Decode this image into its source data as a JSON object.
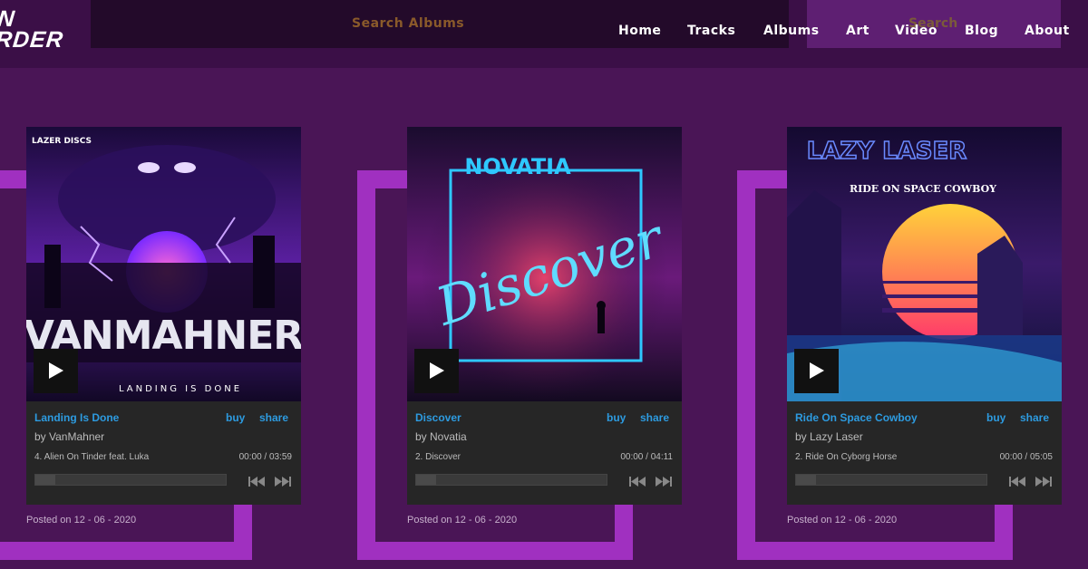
{
  "logo": {
    "line1": "N",
    "line2": "RDER"
  },
  "search": {
    "albums_placeholder": "Search Albums",
    "search_placeholder": "Search"
  },
  "nav": {
    "items": [
      "Home",
      "Tracks",
      "Albums",
      "Art",
      "Video",
      "Blog",
      "About"
    ]
  },
  "cards": [
    {
      "cover_text": "VANMAHNER",
      "cover_sub": "LANDING IS DONE",
      "cover_badge": "LAZER DISCS",
      "title": "Landing Is Done",
      "buy": "buy",
      "share": "share",
      "artist": "by VanMahner",
      "track": "4.  Alien On Tinder feat. Luka",
      "time": "00:00 / 03:59",
      "progress": 0,
      "posted": "Posted on 12 - 06 - 2020"
    },
    {
      "cover_text": "NOVATIA",
      "cover_sub": "Discover",
      "title": "Discover",
      "buy": "buy",
      "share": "share",
      "artist": "by Novatia",
      "track": "2.  Discover",
      "time": "00:00 / 04:11",
      "progress": 0,
      "posted": "Posted on 12 - 06 - 2020"
    },
    {
      "cover_text": "LAZY LASER",
      "cover_sub": "RIDE ON SPACE COWBOY",
      "title": "Ride On Space Cowboy",
      "buy": "buy",
      "share": "share",
      "artist": "by Lazy Laser",
      "track": "2.  Ride On Cyborg Horse",
      "time": "00:00 / 05:05",
      "progress": 0,
      "posted": "Posted on 12 - 06 - 2020"
    }
  ],
  "colors": {
    "accent": "#2d9be0",
    "bracket": "#a030c0",
    "background": "#4a1556"
  }
}
